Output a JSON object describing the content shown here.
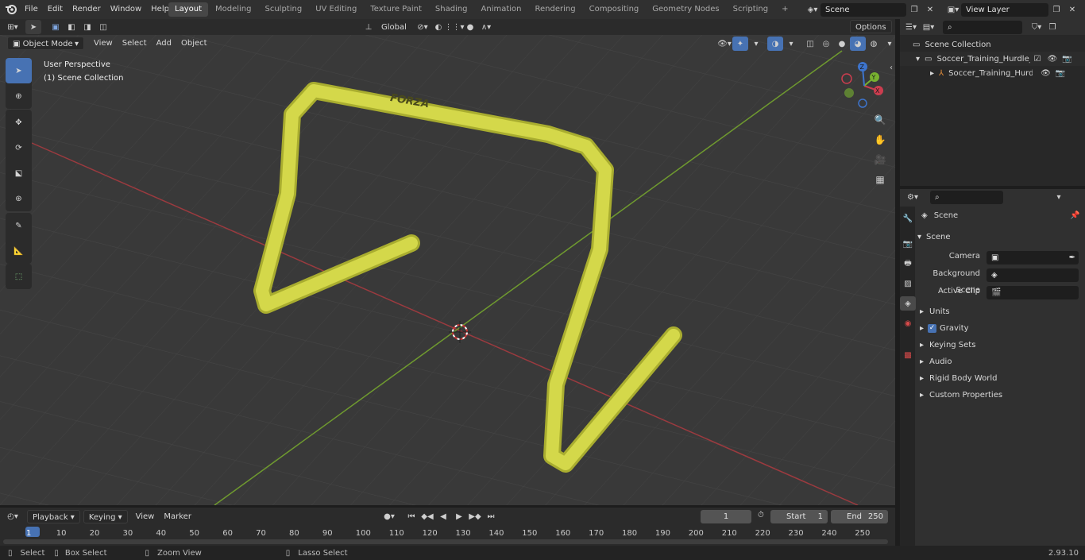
{
  "topbar": {
    "menus": [
      "File",
      "Edit",
      "Render",
      "Window",
      "Help"
    ],
    "workspaces": [
      "Layout",
      "Modeling",
      "Sculpting",
      "UV Editing",
      "Texture Paint",
      "Shading",
      "Animation",
      "Rendering",
      "Compositing",
      "Geometry Nodes",
      "Scripting"
    ],
    "active_workspace": "Layout",
    "scene_field": "Scene",
    "view_layer_field": "View Layer"
  },
  "viewport_header": {
    "mode": "Object Mode",
    "menus": [
      "View",
      "Select",
      "Add",
      "Object"
    ],
    "transform_orientation": "Global",
    "options_label": "Options"
  },
  "viewport": {
    "perspective_label": "User Perspective",
    "collection_label": "(1) Scene Collection",
    "object_text": "FORZA",
    "hurdle_color": "#d4d84a"
  },
  "outliner": {
    "root": "Scene Collection",
    "items": [
      {
        "label": "Soccer_Training_Hurdle_Forza"
      },
      {
        "label": "Soccer_Training_Hurdle_F"
      }
    ]
  },
  "properties": {
    "context_title": "Scene",
    "section_title": "Scene",
    "fields": [
      {
        "label": "Camera"
      },
      {
        "label": "Background Scene"
      },
      {
        "label": "Active Clip"
      }
    ],
    "panels": [
      "Units",
      "Gravity",
      "Keying Sets",
      "Audio",
      "Rigid Body World",
      "Custom Properties"
    ],
    "gravity_checked": true
  },
  "timeline": {
    "menus": [
      "Playback",
      "Keying",
      "View",
      "Marker"
    ],
    "current_frame": "1",
    "start_label": "Start",
    "start_value": "1",
    "end_label": "End",
    "end_value": "250",
    "ticks": [
      "1",
      "10",
      "20",
      "30",
      "40",
      "50",
      "60",
      "70",
      "80",
      "90",
      "100",
      "110",
      "120",
      "130",
      "140",
      "150",
      "160",
      "170",
      "180",
      "190",
      "200",
      "210",
      "220",
      "230",
      "240",
      "250"
    ]
  },
  "statusbar": {
    "select": "Select",
    "box_select": "Box Select",
    "zoom_view": "Zoom View",
    "lasso_select": "Lasso Select",
    "version": "2.93.10"
  },
  "colors": {
    "accent": "#4772b3",
    "x_axis": "#9b3a3f",
    "y_axis": "#6f9a2f"
  }
}
